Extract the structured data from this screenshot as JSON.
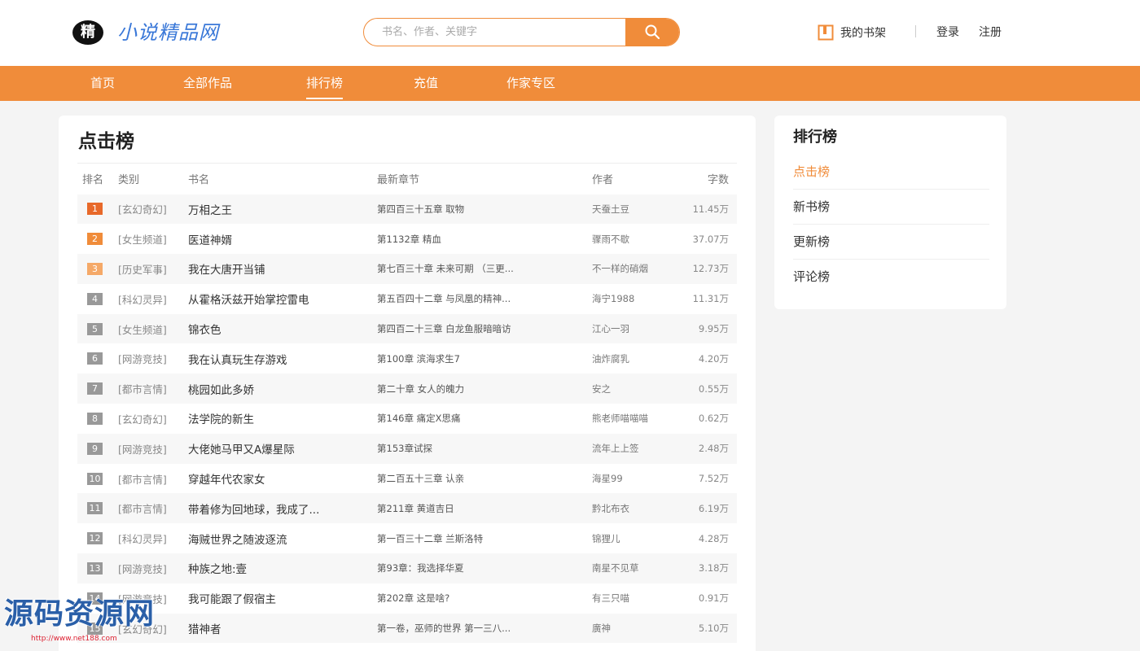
{
  "header": {
    "logo_char": "精",
    "site_name": "小说精品网",
    "search_placeholder": "书名、作者、关键字",
    "shelf_label": "我的书架",
    "login": "登录",
    "register": "注册"
  },
  "nav": {
    "items": [
      "首页",
      "全部作品",
      "排行榜",
      "充值",
      "作家专区"
    ],
    "active": "排行榜"
  },
  "main": {
    "title": "点击榜",
    "columns": [
      "排名",
      "类别",
      "书名",
      "最新章节",
      "作者",
      "字数"
    ],
    "rows": [
      {
        "rank": "1",
        "category": "[玄幻奇幻]",
        "name": "万相之王",
        "chapter": "第四百三十五章 取物",
        "author": "天蚕土豆",
        "words": "11.45万"
      },
      {
        "rank": "2",
        "category": "[女生频道]",
        "name": "医道神婿",
        "chapter": "第1132章 精血",
        "author": "骤雨不歇",
        "words": "37.07万"
      },
      {
        "rank": "3",
        "category": "[历史军事]",
        "name": "我在大唐开当铺",
        "chapter": "第七百三十章 未来可期 （三更...",
        "author": "不一样的硝烟",
        "words": "12.73万"
      },
      {
        "rank": "4",
        "category": "[科幻灵异]",
        "name": "从霍格沃兹开始掌控雷电",
        "chapter": "第五百四十二章 与凤凰的精神...",
        "author": "海宁1988",
        "words": "11.31万"
      },
      {
        "rank": "5",
        "category": "[女生频道]",
        "name": "锦衣色",
        "chapter": "第四百二十三章 白龙鱼服暗暗访",
        "author": "江心一羽",
        "words": "9.95万"
      },
      {
        "rank": "6",
        "category": "[网游竞技]",
        "name": "我在认真玩生存游戏",
        "chapter": "第100章 滨海求生7",
        "author": "油炸腐乳",
        "words": "4.20万"
      },
      {
        "rank": "7",
        "category": "[都市言情]",
        "name": "桃园如此多娇",
        "chapter": "第二十章 女人的魄力",
        "author": "安之",
        "words": "0.55万"
      },
      {
        "rank": "8",
        "category": "[玄幻奇幻]",
        "name": "法学院的新生",
        "chapter": "第146章 痛定X思痛",
        "author": "熊老师喵喵喵",
        "words": "0.62万"
      },
      {
        "rank": "9",
        "category": "[网游竞技]",
        "name": "大佬她马甲又A爆星际",
        "chapter": "第153章试探",
        "author": "流年上上签",
        "words": "2.48万"
      },
      {
        "rank": "10",
        "category": "[都市言情]",
        "name": "穿越年代农家女",
        "chapter": "第二百五十三章 认亲",
        "author": "海星99",
        "words": "7.52万"
      },
      {
        "rank": "11",
        "category": "[都市言情]",
        "name": "带着修为回地球，我成了...",
        "chapter": "第211章 黄道吉日",
        "author": "黔北布衣",
        "words": "6.19万"
      },
      {
        "rank": "12",
        "category": "[科幻灵异]",
        "name": "海贼世界之随波逐流",
        "chapter": "第一百三十二章 兰斯洛特",
        "author": "锦狸儿",
        "words": "4.28万"
      },
      {
        "rank": "13",
        "category": "[网游竞技]",
        "name": "种族之地:壹",
        "chapter": "第93章：我选择华夏",
        "author": "南星不见草",
        "words": "3.18万"
      },
      {
        "rank": "14",
        "category": "[网游竞技]",
        "name": "我可能跟了假宿主",
        "chapter": "第202章 这是啥?",
        "author": "有三只喵",
        "words": "0.91万"
      },
      {
        "rank": "15",
        "category": "[玄幻奇幻]",
        "name": "猎神者",
        "chapter": "第一卷，巫师的世界 第一三八...",
        "author": "廣神",
        "words": "5.10万"
      }
    ]
  },
  "sidebar": {
    "title": "排行榜",
    "items": [
      "点击榜",
      "新书榜",
      "更新榜",
      "评论榜"
    ],
    "active": "点击榜"
  },
  "watermark": {
    "text": "源码资源网",
    "url": "http://www.net188.com"
  },
  "colors": {
    "accent": "#f08c3a",
    "rank1": "#e8692a",
    "rank2": "#f08c3a",
    "rank3": "#f5a968",
    "rank_other": "#999999",
    "logo_blue": "#3a78d8"
  }
}
